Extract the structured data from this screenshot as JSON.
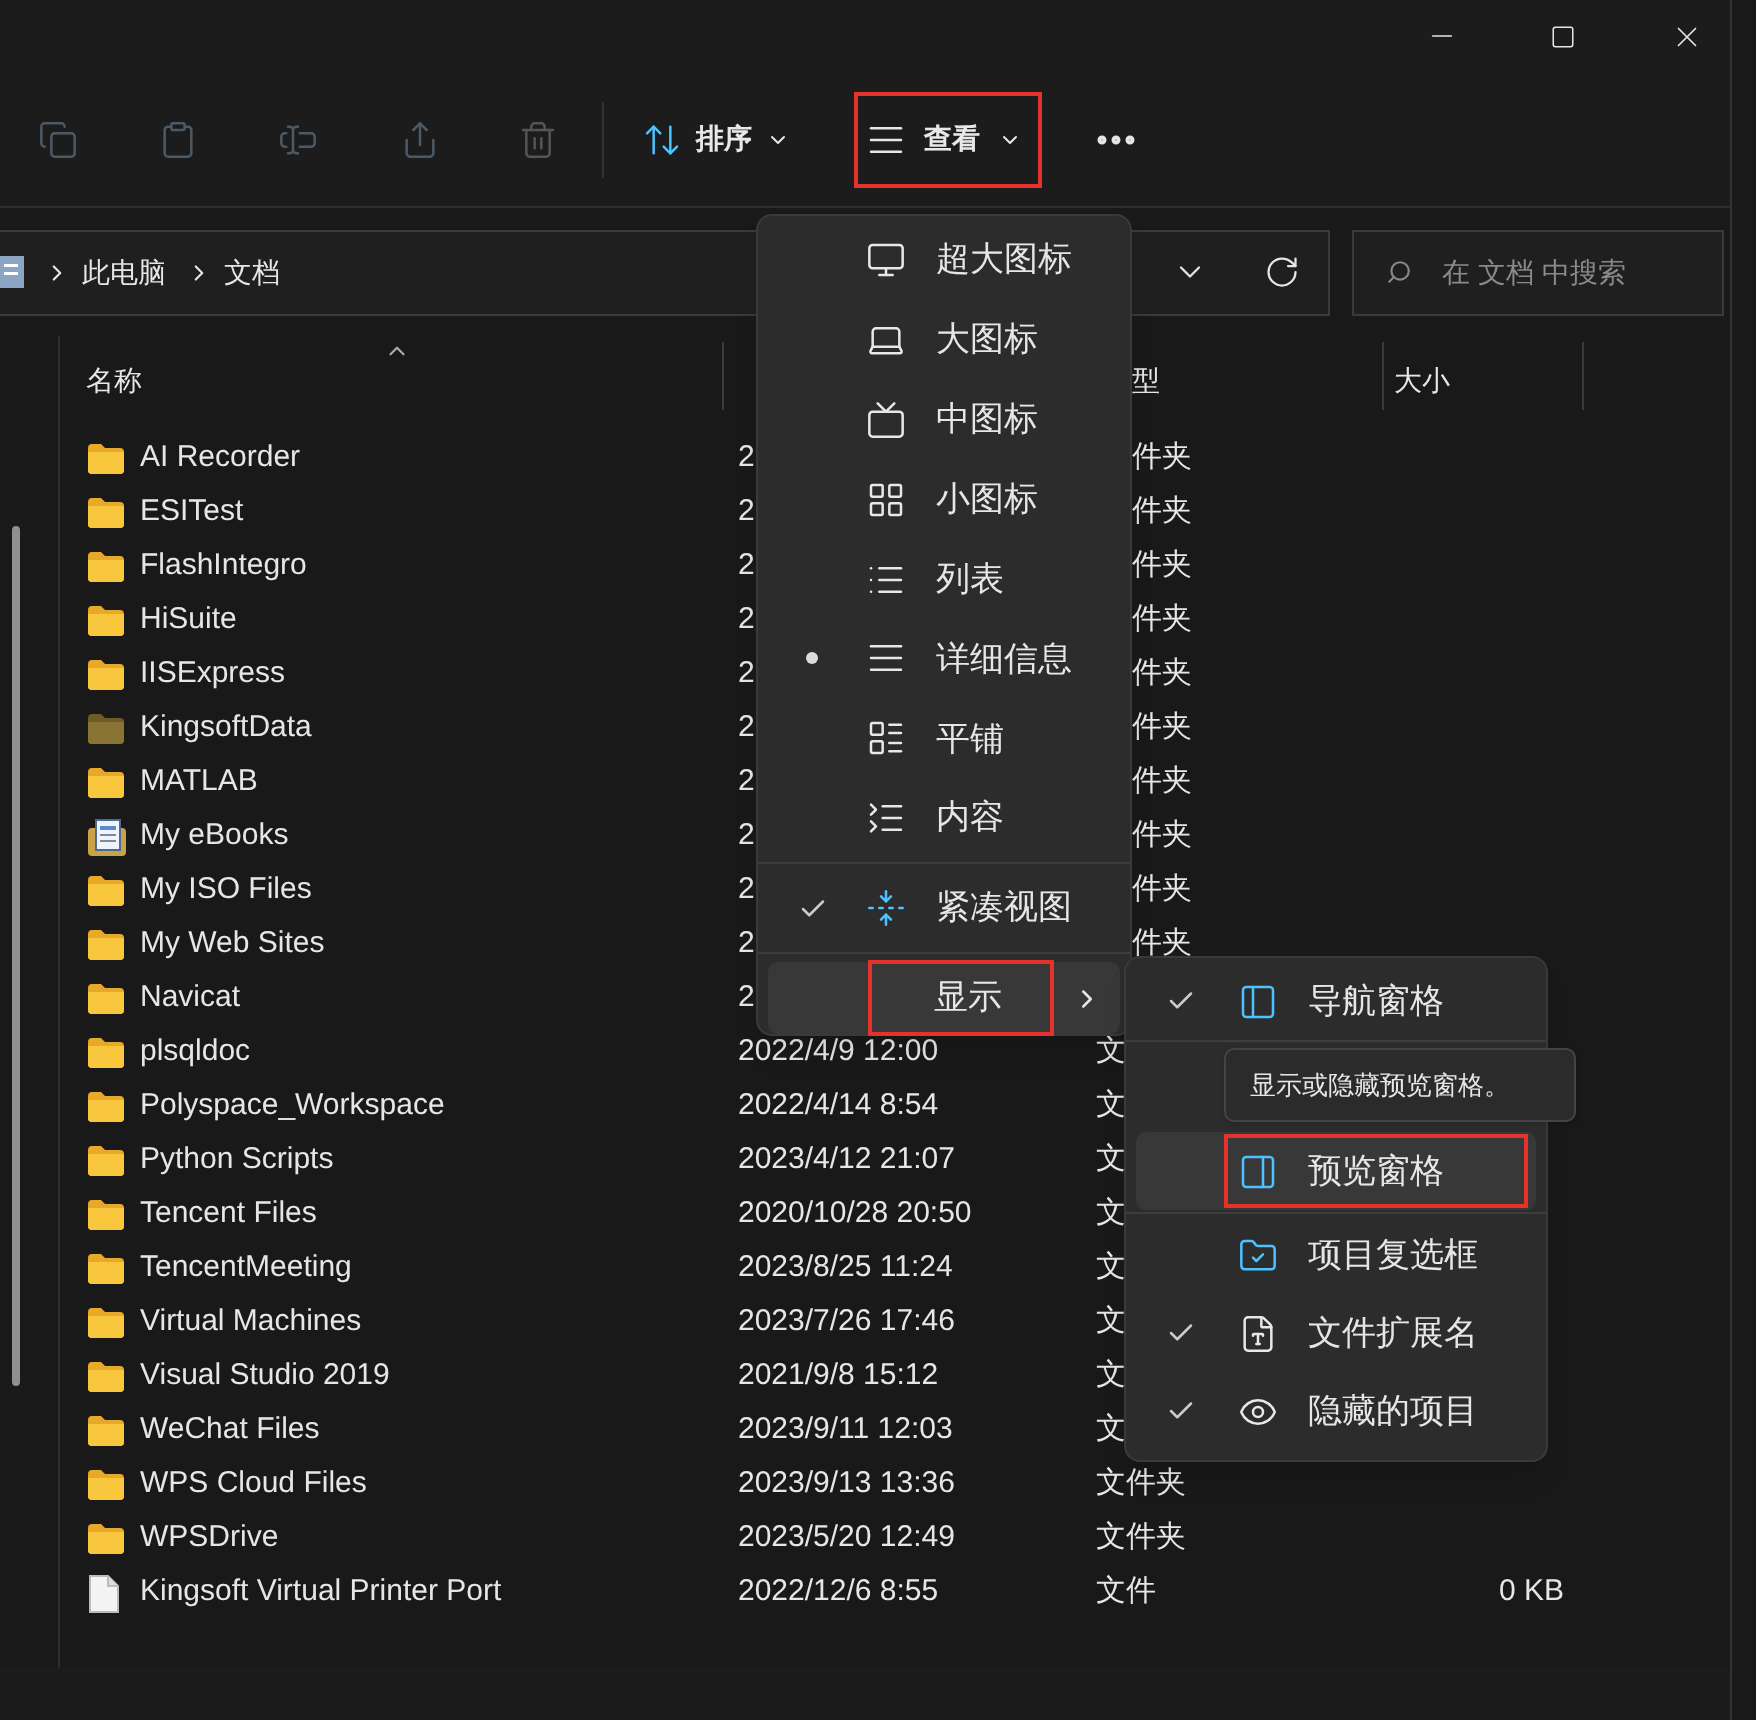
{
  "toolbar": {
    "sort_button": {
      "label": "排序"
    },
    "view_button": {
      "label": "查看",
      "highlighted": true
    }
  },
  "breadcrumb": [
    "此电脑",
    "文档"
  ],
  "search": {
    "placeholder": "在 文档 中搜索"
  },
  "columns": [
    {
      "label": "名称",
      "cut": false
    },
    {
      "label": "型",
      "cut": true
    },
    {
      "label": "大小",
      "cut": false
    }
  ],
  "rows": [
    {
      "kind": "folder",
      "name": "AI Recorder",
      "date": "2",
      "type": "件夹",
      "type_cut": true,
      "size": ""
    },
    {
      "kind": "folder",
      "name": "ESITest",
      "date": "2",
      "type": "件夹",
      "type_cut": true,
      "size": ""
    },
    {
      "kind": "folder",
      "name": "FlashIntegro",
      "date": "2",
      "type": "件夹",
      "type_cut": true,
      "size": ""
    },
    {
      "kind": "folder",
      "name": "HiSuite",
      "date": "2",
      "type": "件夹",
      "type_cut": true,
      "size": ""
    },
    {
      "kind": "folder",
      "name": "IISExpress",
      "date": "2",
      "type": "件夹",
      "type_cut": true,
      "size": ""
    },
    {
      "kind": "folder-dim",
      "name": "KingsoftData",
      "date": "2",
      "type": "件夹",
      "type_cut": true,
      "size": ""
    },
    {
      "kind": "folder",
      "name": "MATLAB",
      "date": "2",
      "type": "件夹",
      "type_cut": true,
      "size": ""
    },
    {
      "kind": "ebook",
      "name": "My eBooks",
      "date": "2",
      "type": "件夹",
      "type_cut": true,
      "size": ""
    },
    {
      "kind": "folder",
      "name": "My ISO Files",
      "date": "2",
      "type": "件夹",
      "type_cut": true,
      "size": ""
    },
    {
      "kind": "folder",
      "name": "My Web Sites",
      "date": "2",
      "type": "件夹",
      "type_cut": true,
      "size": ""
    },
    {
      "kind": "folder",
      "name": "Navicat",
      "date": "2",
      "type": "",
      "size": ""
    },
    {
      "kind": "folder",
      "name": "plsqldoc",
      "date": "2022/4/9 12:00",
      "type": "文",
      "type_cut": false,
      "size": ""
    },
    {
      "kind": "folder",
      "name": "Polyspace_Workspace",
      "date": "2022/4/14 8:54",
      "type": "文",
      "type_cut": false,
      "size": ""
    },
    {
      "kind": "folder",
      "name": "Python Scripts",
      "date": "2023/4/12 21:07",
      "type": "文",
      "type_cut": false,
      "size": ""
    },
    {
      "kind": "folder",
      "name": "Tencent Files",
      "date": "2020/10/28 20:50",
      "type": "文",
      "type_cut": false,
      "size": ""
    },
    {
      "kind": "folder",
      "name": "TencentMeeting",
      "date": "2023/8/25 11:24",
      "type": "文",
      "type_cut": false,
      "size": ""
    },
    {
      "kind": "folder",
      "name": "Virtual Machines",
      "date": "2023/7/26 17:46",
      "type": "文",
      "type_cut": false,
      "size": ""
    },
    {
      "kind": "folder",
      "name": "Visual Studio 2019",
      "date": "2021/9/8 15:12",
      "type": "文",
      "type_cut": false,
      "size": ""
    },
    {
      "kind": "folder",
      "name": "WeChat Files",
      "date": "2023/9/11 12:03",
      "type": "文",
      "type_cut": false,
      "size": ""
    },
    {
      "kind": "folder",
      "name": "WPS Cloud Files",
      "date": "2023/9/13 13:36",
      "type": "文件夹",
      "type_cut": false,
      "size": ""
    },
    {
      "kind": "folder",
      "name": "WPSDrive",
      "date": "2023/5/20 12:49",
      "type": "文件夹",
      "type_cut": false,
      "size": ""
    },
    {
      "kind": "file",
      "name": "Kingsoft Virtual Printer Port",
      "date": "2022/12/6 8:55",
      "type": "文件",
      "type_cut": false,
      "size": "0 KB"
    }
  ],
  "view_menu": [
    {
      "kind": "radio",
      "label": "超大图标",
      "selected": false
    },
    {
      "kind": "radio",
      "label": "大图标",
      "selected": false
    },
    {
      "kind": "radio",
      "label": "中图标",
      "selected": false
    },
    {
      "kind": "radio",
      "label": "小图标",
      "selected": false
    },
    {
      "kind": "radio",
      "label": "列表",
      "selected": false
    },
    {
      "kind": "radio",
      "label": "详细信息",
      "selected": true
    },
    {
      "kind": "radio",
      "label": "平铺",
      "selected": false
    },
    {
      "kind": "radio",
      "label": "内容",
      "selected": false
    },
    {
      "kind": "toggle",
      "label": "紧凑视图",
      "checked": true
    },
    {
      "kind": "submenu",
      "label": "显示",
      "hovered": true,
      "highlighted": true
    }
  ],
  "show_submenu": [
    {
      "label": "导航窗格",
      "checked": true,
      "hovered": false,
      "highlighted": false
    },
    {
      "label": "预览窗格",
      "checked": false,
      "hovered": true,
      "highlighted": true
    },
    {
      "label": "项目复选框",
      "checked": false,
      "hovered": false,
      "highlighted": false
    },
    {
      "label": "文件扩展名",
      "checked": true,
      "hovered": false,
      "highlighted": false
    },
    {
      "label": "隐藏的项目",
      "checked": true,
      "hovered": false,
      "highlighted": false
    }
  ],
  "tooltip": "显示或隐藏预览窗格。"
}
